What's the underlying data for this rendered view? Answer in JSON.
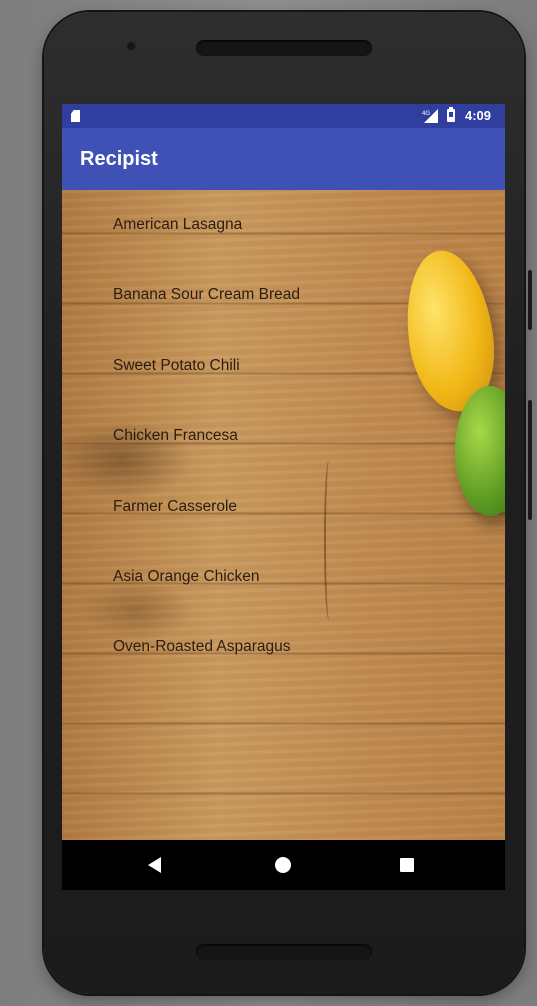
{
  "status_bar": {
    "time": "4:09",
    "icons": [
      "sd-card-icon",
      "signal-icon",
      "battery-icon"
    ]
  },
  "app_bar": {
    "title": "Recipist"
  },
  "recipes": [
    {
      "name": "American Lasagna"
    },
    {
      "name": "Banana Sour Cream Bread"
    },
    {
      "name": "Sweet Potato Chili"
    },
    {
      "name": "Chicken Francesa"
    },
    {
      "name": "Farmer Casserole"
    },
    {
      "name": "Asia Orange Chicken"
    },
    {
      "name": "Oven-Roasted Asparagus"
    }
  ],
  "nav_bar": {
    "icons": [
      "back-icon",
      "home-icon",
      "recents-icon"
    ]
  },
  "colors": {
    "status_bar": "#303f9f",
    "app_bar": "#3f51b5",
    "nav_bar": "#000000",
    "recipe_text": "#2a1d12"
  }
}
